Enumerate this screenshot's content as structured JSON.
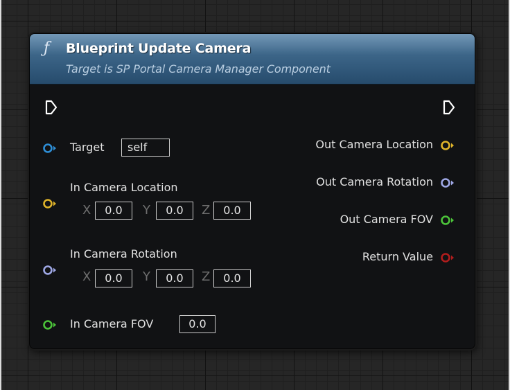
{
  "node": {
    "icon": "function-icon",
    "title": "Blueprint Update Camera",
    "subtitle": "Target is SP Portal Camera Manager Component",
    "header_color": "#3c6588"
  },
  "inputs": {
    "target": {
      "label": "Target",
      "value": "self",
      "color": "#2e8fd8"
    },
    "in_location": {
      "label": "In Camera Location",
      "color": "#e0b42a",
      "x_label": "X",
      "x": "0.0",
      "y_label": "Y",
      "y": "0.0",
      "z_label": "Z",
      "z": "0.0"
    },
    "in_rotation": {
      "label": "In Camera Rotation",
      "color": "#9fa8e6",
      "x_label": "X",
      "x": "0.0",
      "y_label": "Y",
      "y": "0.0",
      "z_label": "Z",
      "z": "0.0"
    },
    "in_fov": {
      "label": "In Camera FOV",
      "value": "0.0",
      "color": "#4cc43a"
    }
  },
  "outputs": {
    "location": {
      "label": "Out Camera Location",
      "color": "#e0b42a"
    },
    "rotation": {
      "label": "Out Camera Rotation",
      "color": "#9fa8e6"
    },
    "fov": {
      "label": "Out Camera FOV",
      "color": "#4cc43a"
    },
    "return_value": {
      "label": "Return Value",
      "color": "#b01d1d"
    }
  }
}
